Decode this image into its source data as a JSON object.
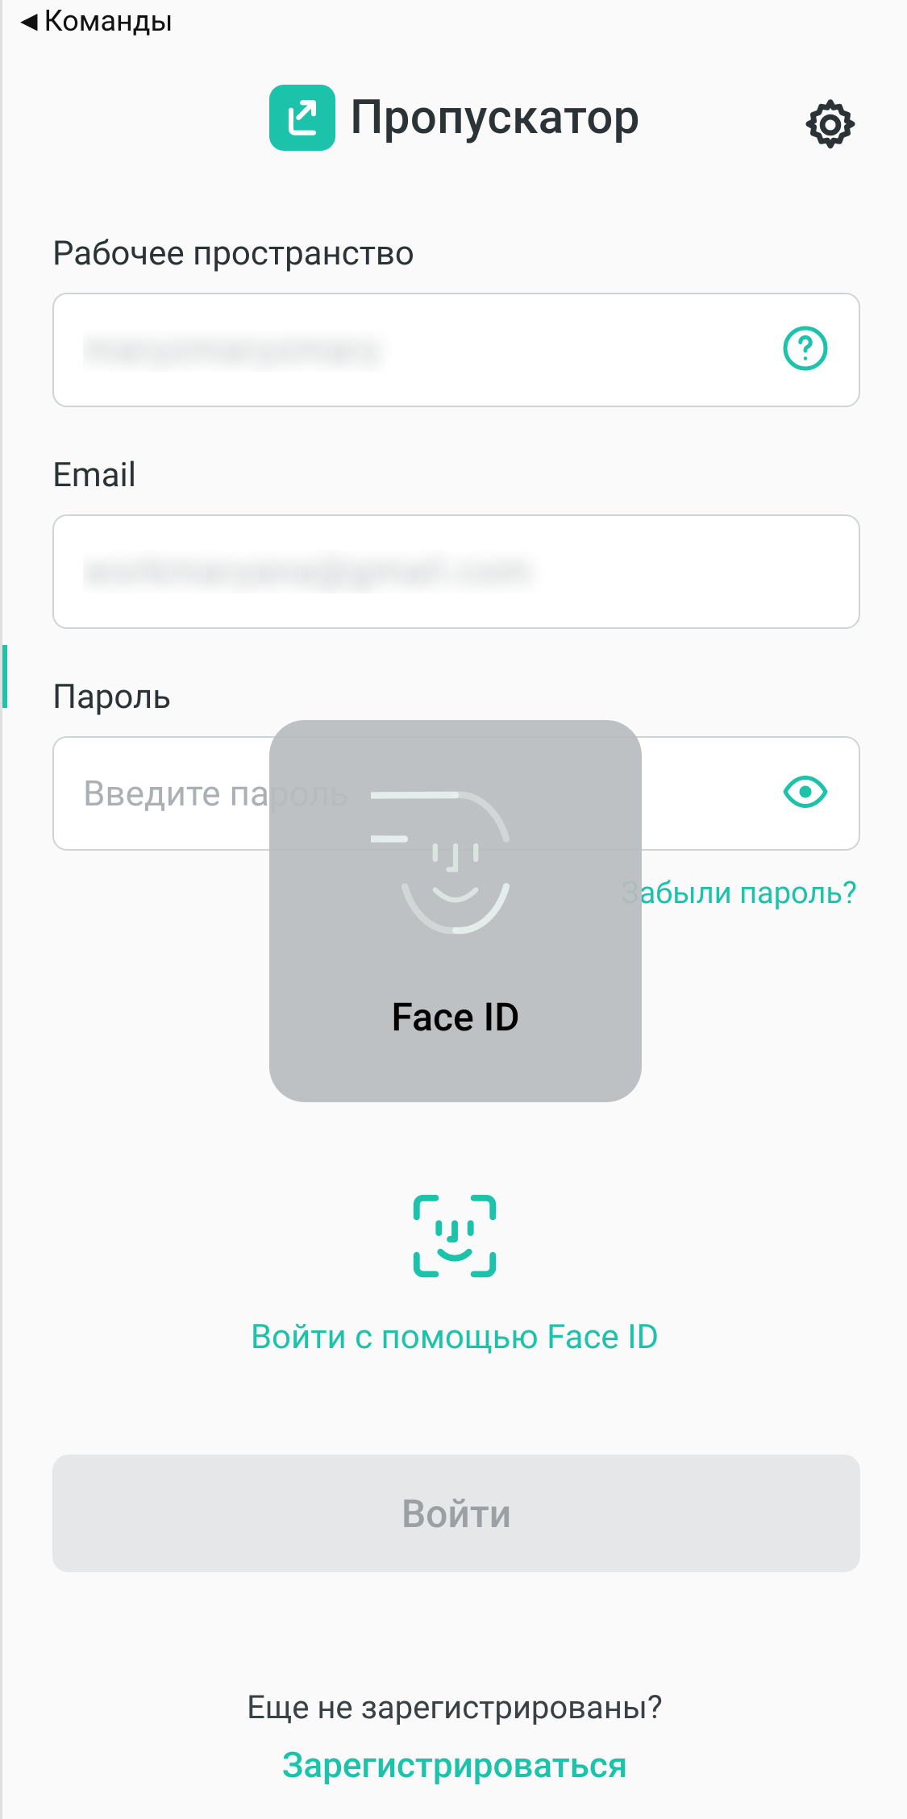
{
  "nav": {
    "back_label": "Команды"
  },
  "header": {
    "title": "Пропускатор"
  },
  "form": {
    "workspace": {
      "label": "Рабочее пространство",
      "value": "maryzmaryzmary"
    },
    "email": {
      "label": "Email",
      "value": "workmaryana@gmail.com"
    },
    "password": {
      "label": "Пароль",
      "placeholder": "Введите пароль"
    },
    "forgot_label": "Забыли пароль?"
  },
  "faceid": {
    "popup_label": "Face ID",
    "login_label": "Войти с помощью Face ID"
  },
  "actions": {
    "login_label": "Войти"
  },
  "register": {
    "prompt": "Еще не зарегистрированы?",
    "link": "Зарегистрироваться"
  },
  "colors": {
    "accent": "#1cc2a9"
  }
}
